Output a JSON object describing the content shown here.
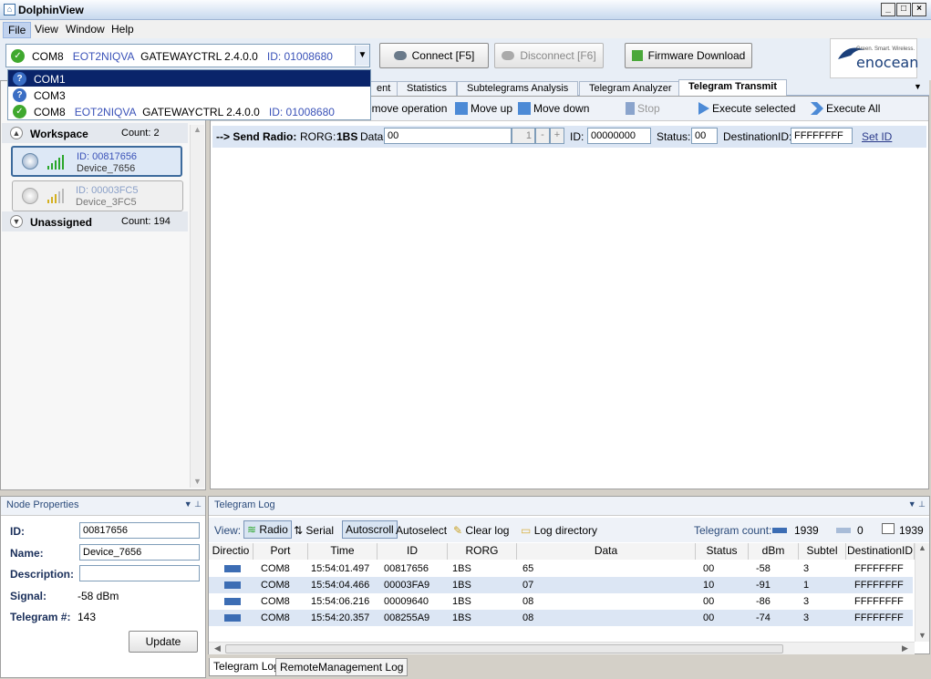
{
  "window": {
    "title": "DolphinView"
  },
  "menu": [
    "File",
    "View",
    "Window",
    "Help"
  ],
  "toolbar": {
    "port_combo": {
      "port": "COM8",
      "device_name": "EOT2NIQVA",
      "gateway": "GATEWAYCTRL 2.4.0.0",
      "id": "ID: 01008680"
    },
    "connect_label": "Connect [F5]",
    "disconnect_label": "Disconnect [F6]",
    "firmware_label": "Firmware Download",
    "logo_tagline": "Green. Smart. Wireless.",
    "logo_text": "enocean"
  },
  "dropdown": {
    "items": [
      {
        "label": "COM1",
        "icon": "question-icon",
        "selected": true
      },
      {
        "label": "COM3",
        "icon": "question-icon",
        "selected": false
      },
      {
        "port": "COM8",
        "device_name": "EOT2NIQVA",
        "gateway": "GATEWAYCTRL 2.4.0.0",
        "id": "ID: 01008680",
        "icon": "check-icon"
      }
    ]
  },
  "tabs": [
    "ent",
    "Statistics",
    "Subtelegrams Analysis",
    "Telegram Analyzer",
    "Telegram Transmit"
  ],
  "active_tab": "Telegram Transmit",
  "workspace": {
    "label": "Workspace",
    "count": "Count: 2",
    "devices": [
      {
        "id": "ID: 00817656",
        "name": "Device_7656",
        "selected": true,
        "signal_bars": 5
      },
      {
        "id": "ID: 00003FC5",
        "name": "Device_3FC5",
        "selected": false,
        "signal_bars": 3
      }
    ],
    "unassigned_label": "Unassigned",
    "unassigned_count": "Count: 194"
  },
  "actions": [
    "emove operation",
    "Move up",
    "Move down",
    "Stop",
    "Execute selected",
    "Execute All"
  ],
  "send_radio": {
    "prefix": "--> Send Radio:",
    "rorg_label": "RORG:",
    "rorg": "1BS",
    "data_label": "Data:",
    "data": "00",
    "counter": "1",
    "id_label": "ID:",
    "id": "00000000",
    "status_label": "Status:",
    "status": "00",
    "dest_label": "DestinationID:",
    "dest": "FFFFFFFF",
    "set_id": "Set ID"
  },
  "node_properties": {
    "title": "Node Properties",
    "id_label": "ID:",
    "id": "00817656",
    "name_label": "Name:",
    "name": "Device_7656",
    "desc_label": "Description:",
    "desc": "",
    "signal_label": "Signal:",
    "signal": "-58 dBm",
    "telegram_label": "Telegram #:",
    "telegram": "143",
    "update_label": "Update"
  },
  "telegram_log": {
    "title": "Telegram Log",
    "view_label": "View:",
    "radio_label": "Radio",
    "serial_label": "Serial",
    "autoscroll_label": "Autoscroll",
    "autoselect_label": "Autoselect",
    "clear_label": "Clear log",
    "dir_label": "Log directory",
    "count_label": "Telegram count:",
    "count_in": "1939",
    "count_out": "0",
    "count_total": "1939",
    "columns": [
      "Directio",
      "Port",
      "Time",
      "ID",
      "RORG",
      "Data",
      "Status",
      "dBm",
      "Subtel",
      "DestinationID"
    ],
    "rows": [
      {
        "port": "COM8",
        "time": "15:54:01.497",
        "id": "00817656",
        "rorg": "1BS",
        "data": "65",
        "status": "00",
        "dbm": "-58",
        "subtel": "3",
        "dest": "FFFFFFFF"
      },
      {
        "port": "COM8",
        "time": "15:54:04.466",
        "id": "00003FA9",
        "rorg": "1BS",
        "data": "07",
        "status": "10",
        "dbm": "-91",
        "subtel": "1",
        "dest": "FFFFFFFF"
      },
      {
        "port": "COM8",
        "time": "15:54:06.216",
        "id": "00009640",
        "rorg": "1BS",
        "data": "08",
        "status": "00",
        "dbm": "-86",
        "subtel": "3",
        "dest": "FFFFFFFF"
      },
      {
        "port": "COM8",
        "time": "15:54:20.357",
        "id": "008255A9",
        "rorg": "1BS",
        "data": "08",
        "status": "00",
        "dbm": "-74",
        "subtel": "3",
        "dest": "FFFFFFFF"
      }
    ]
  },
  "bottom_tabs": [
    "Telegram Log",
    "RemoteManagement Log"
  ]
}
